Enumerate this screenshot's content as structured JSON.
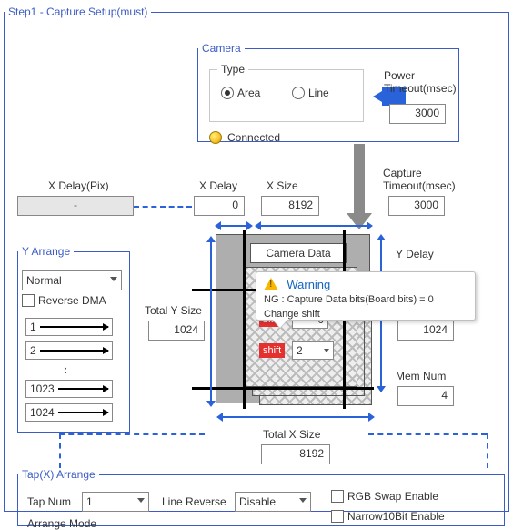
{
  "step1": {
    "legend": "Step1 - Capture Setup(must)"
  },
  "camera": {
    "legend": "Camera",
    "type_label": "Type",
    "area_label": "Area",
    "line_label": "Line",
    "connected_label": "Connected",
    "power_timeout_label": "Power\nTimeout(msec)",
    "power_timeout_value": "3000"
  },
  "xdelay_pix": {
    "label": "X Delay(Pix)",
    "value": "-"
  },
  "xdelay": {
    "label": "X Delay",
    "value": "0"
  },
  "xsize": {
    "label": "X Size",
    "value": "8192"
  },
  "capture_timeout": {
    "label": "Capture\nTimeout(msec)",
    "value": "3000"
  },
  "yarr": {
    "legend": "Y Arrange",
    "mode_value": "Normal",
    "reverse_dma_label": "Reverse DMA",
    "rows": {
      "r1": "1",
      "r2": "2",
      "dots": ":",
      "r3": "1023",
      "r4": "1024"
    }
  },
  "total_y": {
    "label": "Total Y Size",
    "value": "1024"
  },
  "ydelay": {
    "label": "Y Delay"
  },
  "ysize": {
    "value": "1024"
  },
  "memnum": {
    "label": "Mem Num",
    "value": "4"
  },
  "diagram": {
    "camera_data_label": "Camera Data",
    "bits_label": "bits",
    "bits_value": "0",
    "shift_label": "shift",
    "shift_value": "2"
  },
  "tooltip": {
    "title": "Warning",
    "line1": "NG : Capture Data bits(Board bits) = 0",
    "line2": "Change shift"
  },
  "total_x": {
    "label": "Total X Size",
    "value": "8192"
  },
  "tapx": {
    "legend": "Tap(X) Arrange",
    "tapnum_label": "Tap Num",
    "tapnum_value": "1",
    "linerev_label": "Line Reverse",
    "linerev_value": "Disable",
    "rgbswap_label": "RGB Swap Enable",
    "narrow10_label": "Narrow10Bit Enable",
    "arrmode_label": "Arrange Mode"
  }
}
